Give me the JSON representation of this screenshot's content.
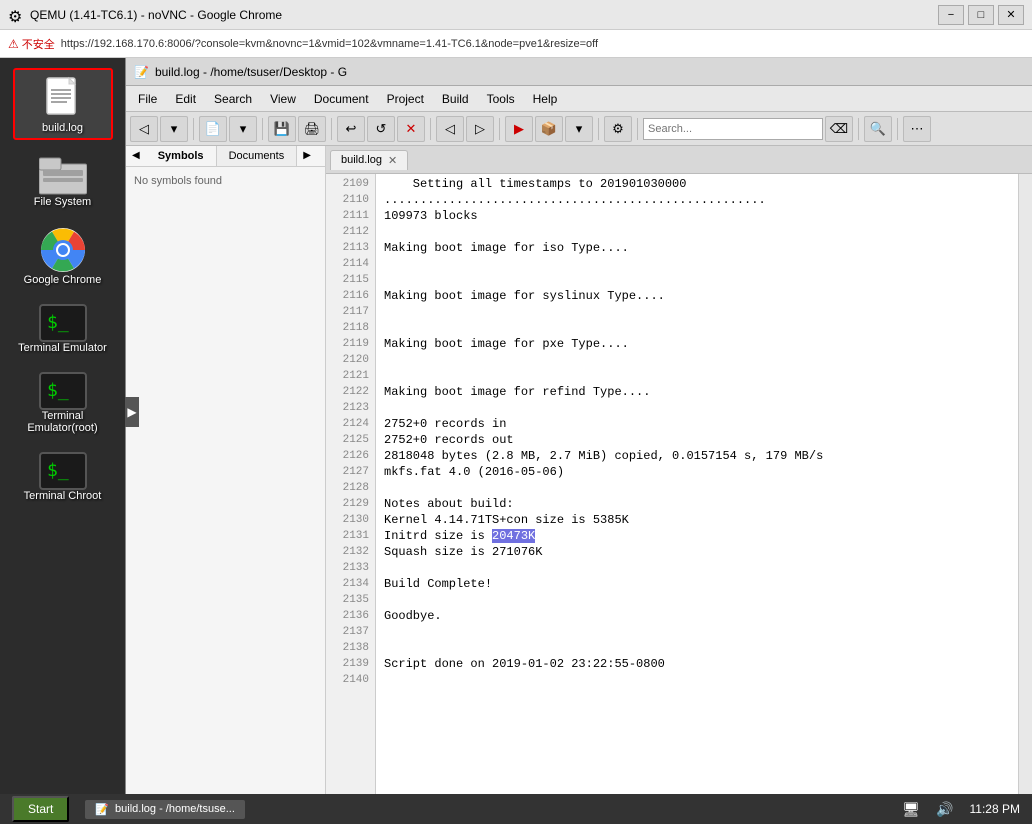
{
  "titlebar": {
    "title": "QEMU (1.41-TC6.1) - noVNC - Google Chrome",
    "icon": "qemu-icon",
    "minimize_label": "−",
    "maximize_label": "□",
    "close_label": "✕"
  },
  "addressbar": {
    "security_label": "不安全",
    "url": "https://192.168.170.6:8006/?console=kvm&novnc=1&vmid=102&vmname=1.41-TC6.1&node=pve1&resize=off"
  },
  "desktop": {
    "icons": [
      {
        "id": "build-log",
        "label": "build.log",
        "type": "file"
      },
      {
        "id": "file-system",
        "label": "File System",
        "type": "filesystem"
      },
      {
        "id": "google-chrome",
        "label": "Google Chrome",
        "type": "chrome"
      },
      {
        "id": "terminal-emulator",
        "label": "Terminal Emulator",
        "type": "terminal"
      },
      {
        "id": "terminal-root",
        "label": "Terminal\nEmulator(root)",
        "type": "terminal"
      },
      {
        "id": "terminal-chroot",
        "label": "Terminal Chroot",
        "type": "terminal"
      }
    ]
  },
  "gedit": {
    "title": "build.log - /home/tsuser/Desktop - G",
    "menu": [
      "File",
      "Edit",
      "Search",
      "View",
      "Document",
      "Project",
      "Build",
      "Tools",
      "Help"
    ],
    "tab_label": "build.log",
    "sidebar": {
      "tabs": [
        "Symbols",
        "Documents"
      ],
      "content": "No symbols found"
    },
    "lines": [
      {
        "num": "2109",
        "text": "    Setting all timestamps to 201901030000"
      },
      {
        "num": "2110",
        "text": "....................................................."
      },
      {
        "num": "2111",
        "text": "109973 blocks"
      },
      {
        "num": "2112",
        "text": ""
      },
      {
        "num": "2113",
        "text": "Making boot image for iso Type...."
      },
      {
        "num": "2114",
        "text": ""
      },
      {
        "num": "2115",
        "text": ""
      },
      {
        "num": "2116",
        "text": "Making boot image for syslinux Type...."
      },
      {
        "num": "2117",
        "text": ""
      },
      {
        "num": "2118",
        "text": ""
      },
      {
        "num": "2119",
        "text": "Making boot image for pxe Type...."
      },
      {
        "num": "2120",
        "text": ""
      },
      {
        "num": "2121",
        "text": ""
      },
      {
        "num": "2122",
        "text": "Making boot image for refind Type...."
      },
      {
        "num": "2123",
        "text": ""
      },
      {
        "num": "2124",
        "text": "2752+0 records in"
      },
      {
        "num": "2125",
        "text": "2752+0 records out"
      },
      {
        "num": "2126",
        "text": "2818048 bytes (2.8 MB, 2.7 MiB) copied, 0.0157154 s, 179 MB/s"
      },
      {
        "num": "2127",
        "text": "mkfs.fat 4.0 (2016-05-06)"
      },
      {
        "num": "2128",
        "text": ""
      },
      {
        "num": "2129",
        "text": "Notes about build:"
      },
      {
        "num": "2130",
        "text": "Kernel 4.14.71TS+con size is 5385K"
      },
      {
        "num": "2131",
        "text": "Initrd size is ",
        "highlight": "20473K"
      },
      {
        "num": "2132",
        "text": "Squash size is 271076K"
      },
      {
        "num": "2133",
        "text": ""
      },
      {
        "num": "2134",
        "text": "Build Complete!"
      },
      {
        "num": "2135",
        "text": ""
      },
      {
        "num": "2136",
        "text": "Goodbye."
      },
      {
        "num": "2137",
        "text": ""
      },
      {
        "num": "2138",
        "text": ""
      },
      {
        "num": "2139",
        "text": "Script done on 2019-01-02 23:22:55-0800"
      },
      {
        "num": "2140",
        "text": ""
      }
    ]
  },
  "statusbar": {
    "start_label": "Start",
    "tab_label": "build.log - /home/tsuse...",
    "time": "11:28 PM",
    "network_icon": "🖧",
    "volume_icon": "🔊"
  }
}
